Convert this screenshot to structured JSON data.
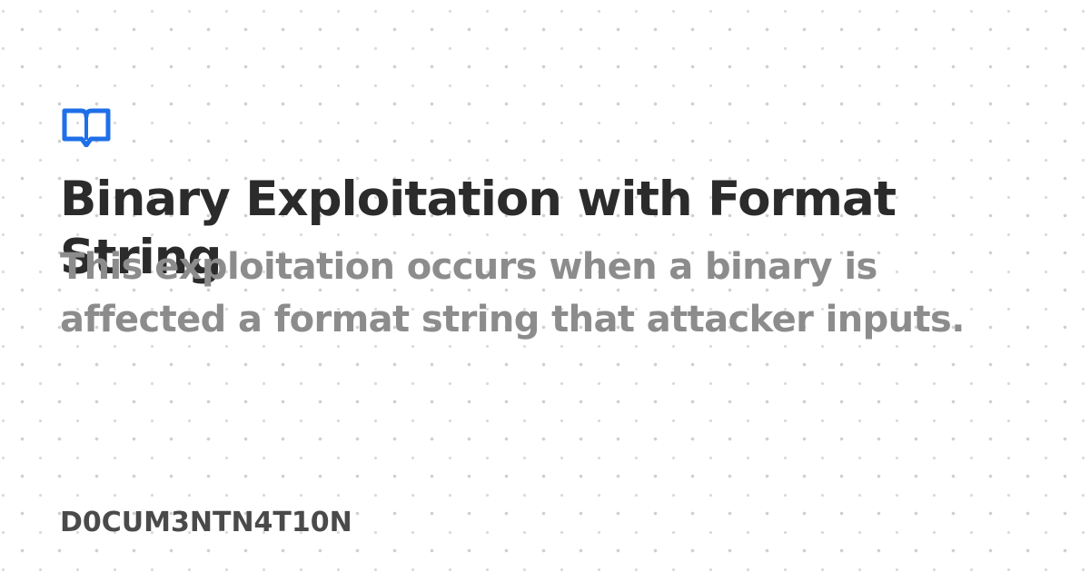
{
  "card": {
    "logo_icon": "open-book-icon",
    "logo_color": "#1f6fe8",
    "title": "Binary Exploitation with Format String",
    "description": "This exploitation occurs when a binary is affected a format string that attacker inputs.",
    "site_name": "D0CUM3NTN4T10N",
    "background": "#ffffff",
    "dot_color": "#cfcfcf",
    "title_color": "#2b2b2b",
    "description_color": "#8c8c8c",
    "site_name_color": "#4a4a4a"
  }
}
